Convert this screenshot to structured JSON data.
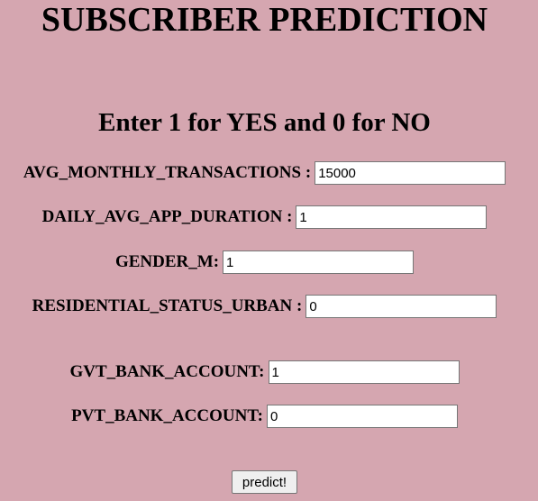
{
  "page": {
    "title": "SUBSCRIBER PREDICTION",
    "subtitle": "Enter 1 for YES and 0 for NO",
    "background_color": "#d5a6b0"
  },
  "form": {
    "fields": [
      {
        "label": "AVG_MONTHLY_TRANSACTIONS :",
        "value": "15000"
      },
      {
        "label": "DAILY_AVG_APP_DURATION :",
        "value": "1"
      },
      {
        "label": "GENDER_M:",
        "value": "1"
      },
      {
        "label": "RESIDENTIAL_STATUS_URBAN :",
        "value": "0"
      },
      {
        "label": "GVT_BANK_ACCOUNT:",
        "value": "1"
      },
      {
        "label": "PVT_BANK_ACCOUNT:",
        "value": "0"
      }
    ],
    "submit_label": "predict!"
  }
}
